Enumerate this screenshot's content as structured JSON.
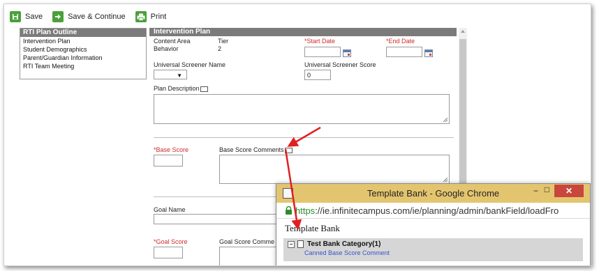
{
  "toolbar": {
    "save_label": "Save",
    "save_continue_label": "Save & Continue",
    "print_label": "Print"
  },
  "outline": {
    "header": "RTI Plan Outline",
    "items": [
      "Intervention Plan",
      "Student Demographics",
      "Parent/Guardian Information",
      "RTI Team Meeting"
    ]
  },
  "form": {
    "header": "Intervention Plan",
    "content_area_label": "Content Area",
    "content_area_value": "Behavior",
    "tier_label": "Tier",
    "tier_value": "2",
    "start_date_label": "*Start Date",
    "end_date_label": "*End Date",
    "screener_name_label": "Universal Screener Name",
    "screener_score_label": "Universal Screener Score",
    "screener_score_value": "0",
    "plan_description_label": "Plan Description",
    "base_score_label": "*Base Score",
    "base_score_comments_label": "Base Score Comments",
    "goal_name_label": "Goal Name",
    "goal_score_label": "*Goal Score",
    "goal_score_comments_label": "Goal Score Comme"
  },
  "popup": {
    "title": "Template Bank - Google Chrome",
    "url_https": "https",
    "url_rest": "://ie.infinitecampus.com/ie/planning/admin/bankField/loadFro",
    "heading": "Template Bank",
    "category": "Test Bank Category(1)",
    "comment": "Canned Base Score Comment",
    "minimize": "−",
    "maximize": "□",
    "close": "✕"
  },
  "colors": {
    "header_gray": "#7b7b7b",
    "required_red": "#cc2b2b",
    "toolbar_green": "#4aa03a",
    "popup_title_bar": "#e4c56f",
    "annotation_red": "#e02020",
    "link_blue": "#3355cc"
  }
}
